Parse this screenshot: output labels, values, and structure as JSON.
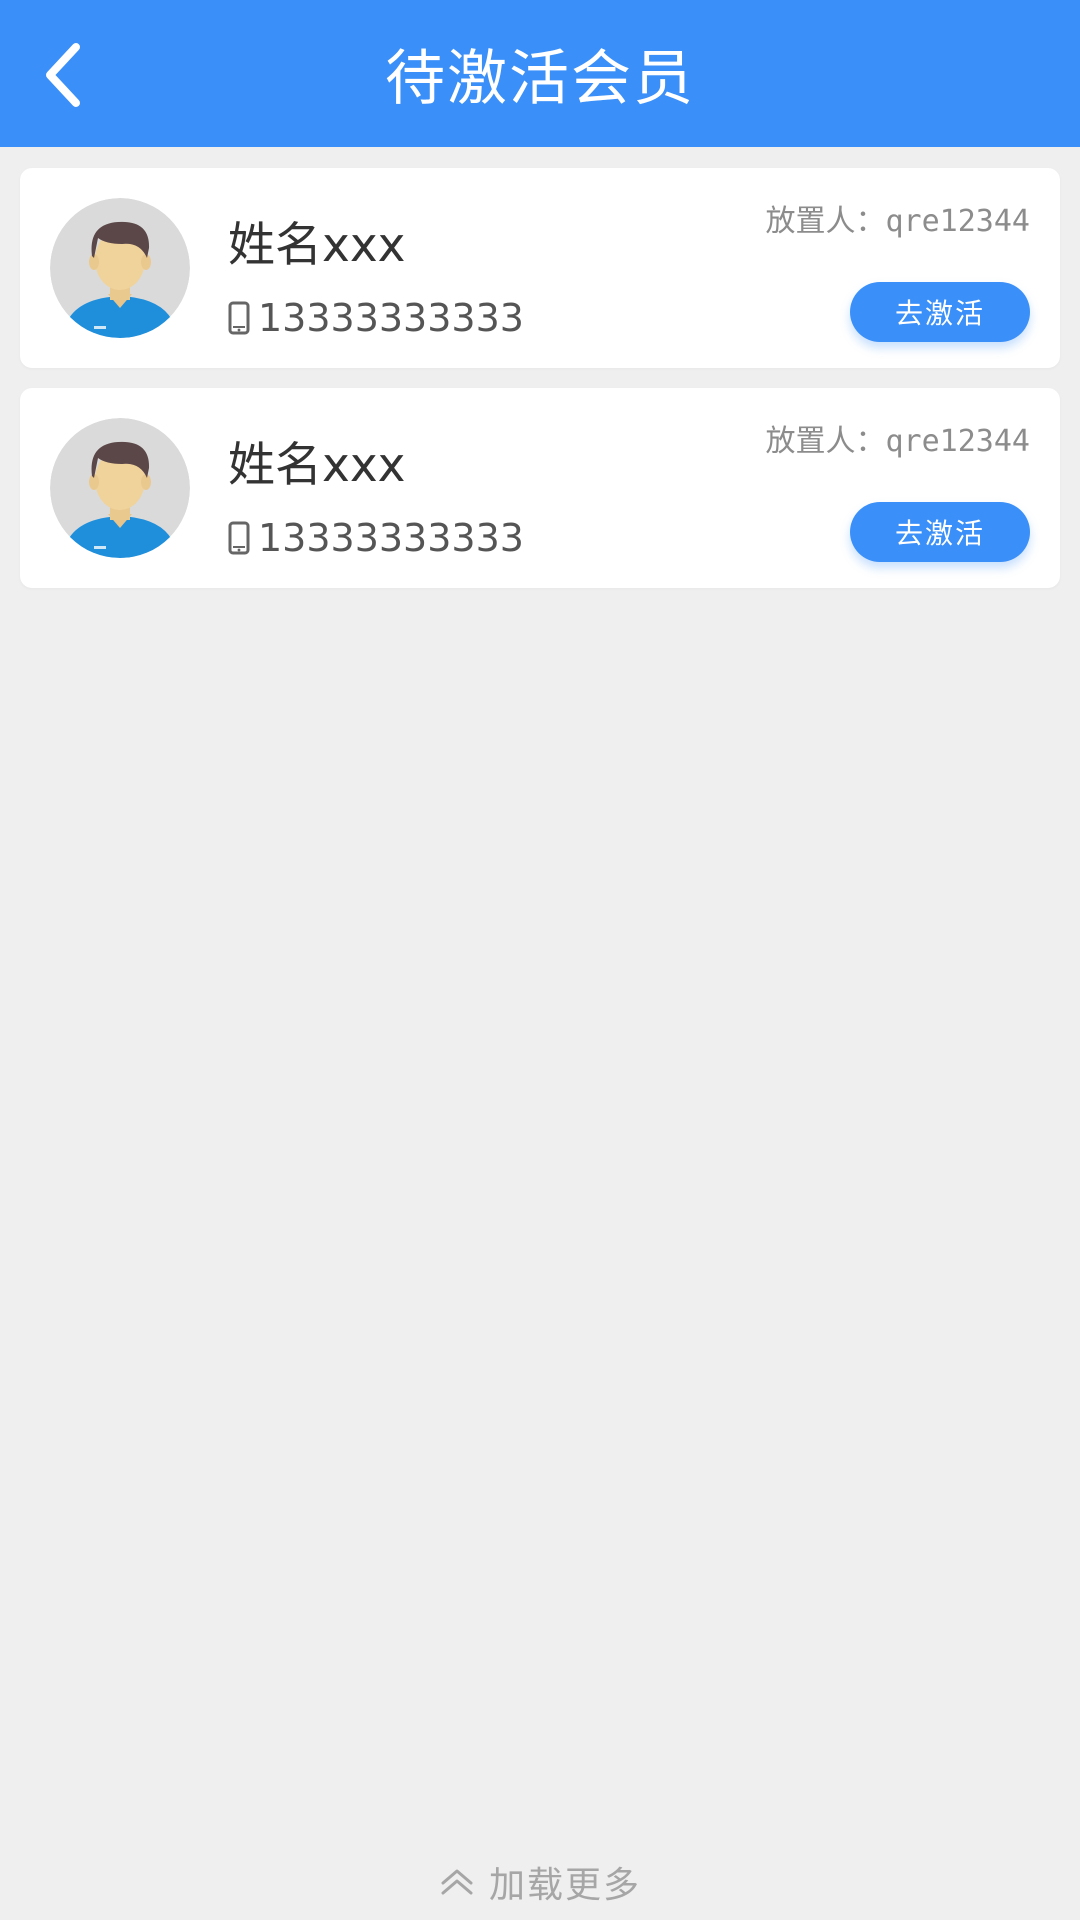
{
  "header": {
    "title": "待激活会员",
    "back_icon": "chevron-left-icon",
    "background_color": "#3a8ff8"
  },
  "members": [
    {
      "name": "姓名xxx",
      "phone": "13333333333",
      "placer": "放置人：qre12344",
      "action_label": "去激活",
      "avatar_icon": "male-avatar-icon",
      "phone_icon": "mobile-phone-icon"
    },
    {
      "name": "姓名xxx",
      "phone": "13333333333",
      "placer": "放置人：qre12344",
      "action_label": "去激活",
      "avatar_icon": "male-avatar-icon",
      "phone_icon": "mobile-phone-icon"
    }
  ],
  "footer": {
    "load_more_label": "加载更多",
    "load_more_icon": "double-chevron-up-icon"
  },
  "colors": {
    "accent": "#3a8ff8",
    "background": "#efeff0"
  }
}
